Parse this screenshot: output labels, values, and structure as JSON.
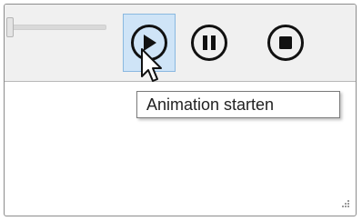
{
  "toolbar": {
    "slider": {
      "value": 0.0
    },
    "buttons": [
      {
        "name": "play",
        "icon": "play-icon",
        "selected": true
      },
      {
        "name": "pause",
        "icon": "pause-icon",
        "selected": false
      },
      {
        "name": "stop",
        "icon": "stop-icon",
        "selected": false
      }
    ]
  },
  "tooltip": {
    "text": "Animation starten"
  },
  "colors": {
    "toolbar_bg": "#f0f0f0",
    "selected_bg": "#cfe4f7",
    "selected_border": "#8ab8e0",
    "icon": "#111111"
  },
  "cursor": {
    "icon": "arrow-cursor-icon"
  }
}
